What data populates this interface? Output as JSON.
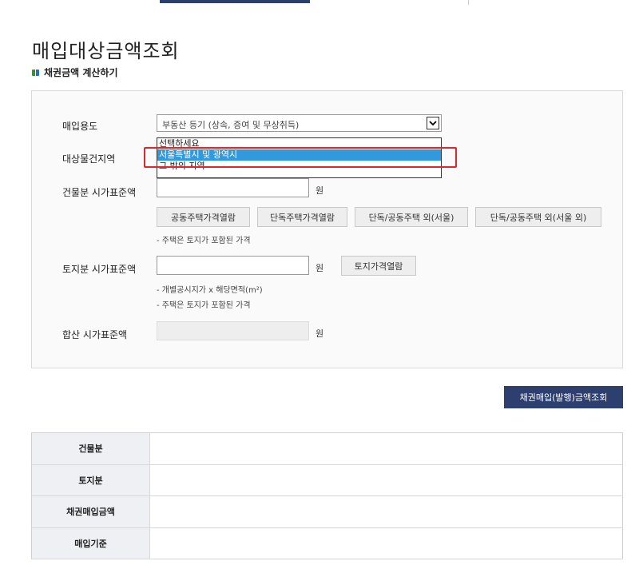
{
  "page": {
    "title": "매입대상금액조회",
    "section_title": "채권금액 계산하기"
  },
  "form": {
    "purpose_label": "매입용도",
    "purpose_selected": "부동산 등기 (상속, 증여 및 무상취득)",
    "region_label": "대상물건지역",
    "region_options": [
      "선택하세요",
      "서울특별시 및 광역시",
      "그 밖의 지역"
    ],
    "region_highlighted_index": 1,
    "building_label": "건물분 시가표준액",
    "building_unit": "원",
    "building_buttons": [
      "공동주택가격열람",
      "단독주택가격열람",
      "단독/공동주택 외(서울)",
      "단독/공동주택 외(서울 외)"
    ],
    "building_note": "- 주택은 토지가 포함된 가격",
    "land_label": "토지분 시가표준액",
    "land_unit": "원",
    "land_button": "토지가격열람",
    "land_note_1": "- 개별공시지가 x 해당면적(m²)",
    "land_note_2": "- 주택은 토지가 포함된 가격",
    "total_label": "합산 시가표준액",
    "total_unit": "원"
  },
  "query_button": "채권매입(발행)금액조회",
  "results": {
    "rows": [
      "건물분",
      "토지분",
      "채권매입금액",
      "매입기준"
    ]
  },
  "colors": {
    "accent": "#2d3f6e",
    "highlight_red": "#e0262b",
    "selected_option": "#3399dd"
  }
}
